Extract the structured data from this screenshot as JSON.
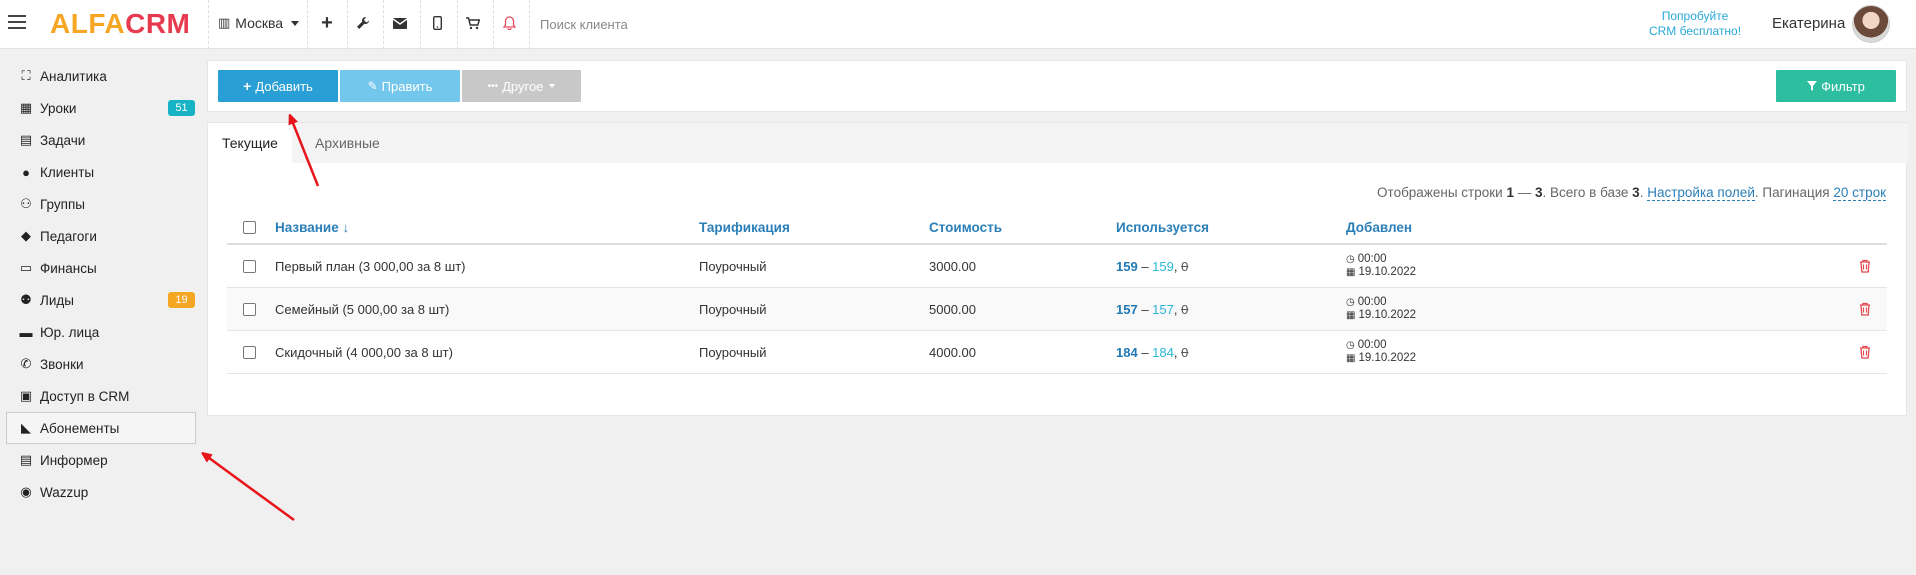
{
  "app": {
    "logo_part1": "ALFA",
    "logo_part2": "CRM",
    "city": "Москва",
    "search_placeholder": "Поиск клиента",
    "try_line1": "Попробуйте",
    "try_line2": "CRM бесплатно!",
    "user_name": "Екатерина"
  },
  "sidebar": {
    "items": [
      {
        "label": "Аналитика",
        "icon": "map-icon"
      },
      {
        "label": "Уроки",
        "icon": "calendar-icon",
        "badge": "51",
        "badge_color": "#17b3c4"
      },
      {
        "label": "Задачи",
        "icon": "clipboard-icon"
      },
      {
        "label": "Клиенты",
        "icon": "user-icon"
      },
      {
        "label": "Группы",
        "icon": "users-icon"
      },
      {
        "label": "Педагоги",
        "icon": "graduation-cap-icon"
      },
      {
        "label": "Финансы",
        "icon": "money-icon"
      },
      {
        "label": "Лиды",
        "icon": "user-plus-icon",
        "badge": "19",
        "badge_color": "#f5a623"
      },
      {
        "label": "Юр. лица",
        "icon": "briefcase-icon"
      },
      {
        "label": "Звонки",
        "icon": "phone-icon"
      },
      {
        "label": "Доступ в CRM",
        "icon": "lock-icon"
      },
      {
        "label": "Абонементы",
        "icon": "tag-icon",
        "active": true
      },
      {
        "label": "Информер",
        "icon": "newspaper-icon"
      },
      {
        "label": "Wazzup",
        "icon": "whatsapp-icon"
      }
    ]
  },
  "toolbar": {
    "add_label": "Добавить",
    "edit_label": "Править",
    "other_label": "Другое",
    "filter_label": "Фильтр"
  },
  "tabs": {
    "current": "Текущие",
    "archive": "Архивные"
  },
  "info": {
    "prefix": "Отображены строки",
    "from": "1",
    "dash": "—",
    "to": "3",
    "total_prefix": ". Всего в базе",
    "total": "3",
    "settings_link": "Настройка полей",
    "pagination_label": ". Пагинация",
    "pagination_link": "20 строк"
  },
  "table": {
    "headers": {
      "name": "Название ↓",
      "tariff": "Тарификация",
      "cost": "Стоимость",
      "used": "Используется",
      "added": "Добавлен"
    },
    "rows": [
      {
        "name": "Первый план (3 000,00 за 8 шт)",
        "tariff": "Поурочный",
        "cost": "3000.00",
        "used_a": "159",
        "used_b": "159",
        "used_c": "0",
        "time": "00:00",
        "date": "19.10.2022"
      },
      {
        "name": "Семейный (5 000,00 за 8 шт)",
        "tariff": "Поурочный",
        "cost": "5000.00",
        "used_a": "157",
        "used_b": "157",
        "used_c": "0",
        "time": "00:00",
        "date": "19.10.2022"
      },
      {
        "name": "Скидочный (4 000,00 за 8 шт)",
        "tariff": "Поурочный",
        "cost": "4000.00",
        "used_a": "184",
        "used_b": "184",
        "used_c": "0",
        "time": "00:00",
        "date": "19.10.2022"
      }
    ]
  },
  "colors": {
    "accent_blue": "#2a9fd6",
    "teal": "#2dbd9f",
    "red_arrow": "#e8141b"
  }
}
